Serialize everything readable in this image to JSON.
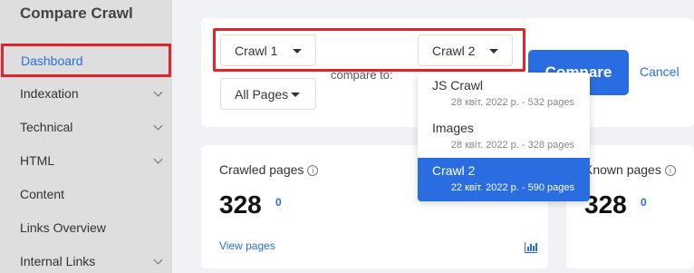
{
  "app": {
    "title": "Compare Crawl"
  },
  "sidebar": {
    "items": [
      {
        "label": "Dashboard",
        "active": true,
        "has_chevron": false
      },
      {
        "label": "Indexation",
        "has_chevron": true
      },
      {
        "label": "Technical",
        "has_chevron": true
      },
      {
        "label": "HTML",
        "has_chevron": true
      },
      {
        "label": "Content",
        "has_chevron": false
      },
      {
        "label": "Links Overview",
        "has_chevron": false
      },
      {
        "label": "Internal Links",
        "has_chevron": true
      }
    ]
  },
  "compare": {
    "crawl1_value": "Crawl 1",
    "crawl2_value": "Crawl 2",
    "pages_value": "All Pages",
    "compare_to_label": "compare to:",
    "compare_button": "Compare",
    "cancel_link": "Cancel"
  },
  "dropdown": {
    "options": [
      {
        "name": "JS Crawl",
        "meta": "28 квіт. 2022 р. - 532 pages",
        "selected": false
      },
      {
        "name": "Images",
        "meta": "28 квіт. 2022 р. - 328 pages",
        "selected": false
      },
      {
        "name": "Crawl 2",
        "meta": "22 квіт. 2022 р. - 590 pages",
        "selected": true
      }
    ]
  },
  "stats": {
    "crawled": {
      "label": "Crawled pages",
      "value": "328",
      "delta": "0",
      "link": "View pages"
    },
    "known": {
      "label": "Known pages",
      "value": "328",
      "delta": "0"
    }
  },
  "colors": {
    "accent": "#2a6de0",
    "highlight": "#e0242c",
    "sidebar_bg": "#dedede"
  }
}
